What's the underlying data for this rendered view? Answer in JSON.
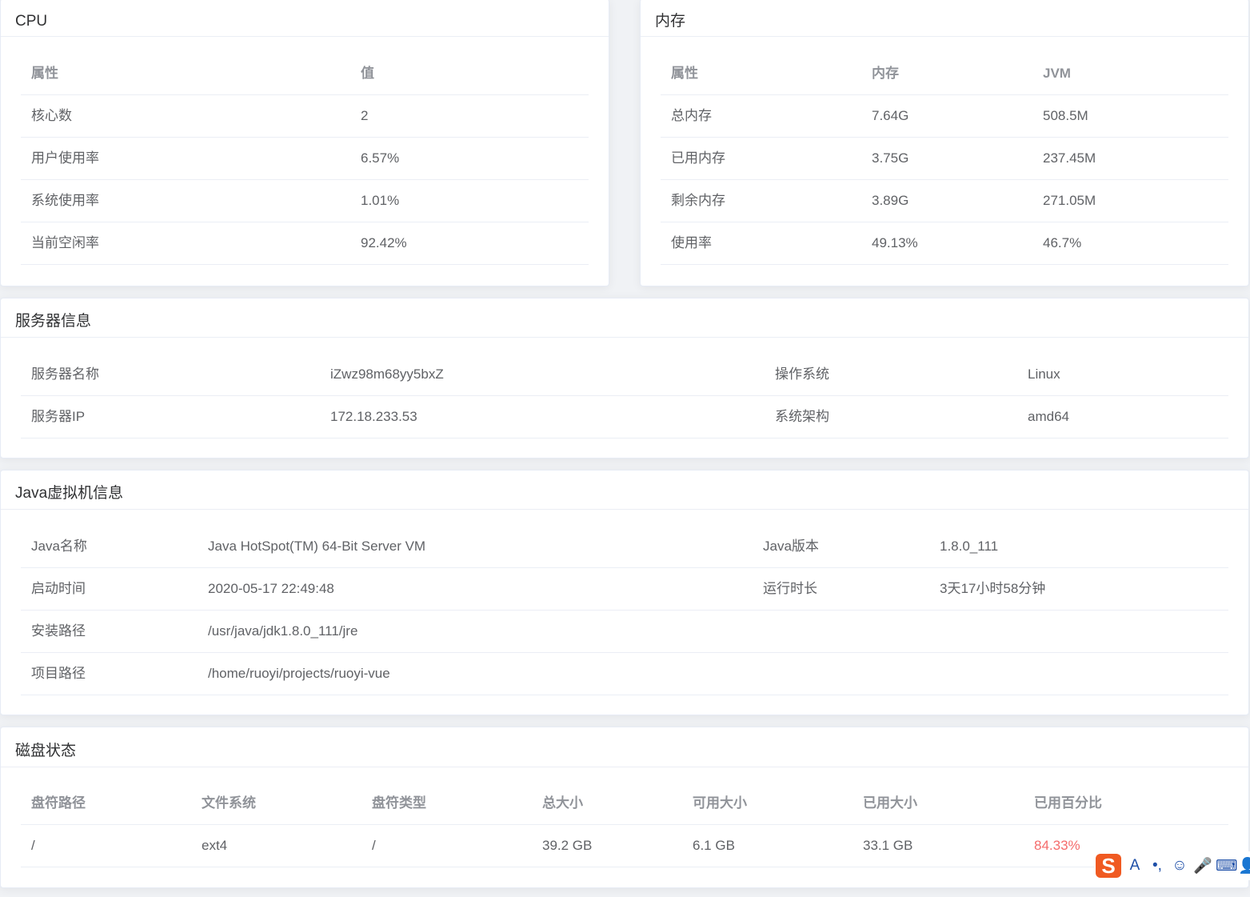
{
  "cpu": {
    "title": "CPU",
    "headers": [
      "属性",
      "值"
    ],
    "rows": [
      [
        "核心数",
        "2"
      ],
      [
        "用户使用率",
        "6.57%"
      ],
      [
        "系统使用率",
        "1.01%"
      ],
      [
        "当前空闲率",
        "92.42%"
      ]
    ]
  },
  "mem": {
    "title": "内存",
    "headers": [
      "属性",
      "内存",
      "JVM"
    ],
    "rows": [
      [
        "总内存",
        "7.64G",
        "508.5M"
      ],
      [
        "已用内存",
        "3.75G",
        "237.45M"
      ],
      [
        "剩余内存",
        "3.89G",
        "271.05M"
      ],
      [
        "使用率",
        "49.13%",
        "46.7%"
      ]
    ]
  },
  "server": {
    "title": "服务器信息",
    "rows": [
      [
        "服务器名称",
        "iZwz98m68yy5bxZ",
        "操作系统",
        "Linux"
      ],
      [
        "服务器IP",
        "172.18.233.53",
        "系统架构",
        "amd64"
      ]
    ]
  },
  "jvm": {
    "title": "Java虚拟机信息",
    "rows": [
      [
        "Java名称",
        "Java HotSpot(TM) 64-Bit Server VM",
        "Java版本",
        "1.8.0_111"
      ],
      [
        "启动时间",
        "2020-05-17 22:49:48",
        "运行时长",
        "3天17小时58分钟"
      ],
      [
        "安装路径",
        "/usr/java/jdk1.8.0_111/jre",
        "",
        ""
      ],
      [
        "项目路径",
        "/home/ruoyi/projects/ruoyi-vue",
        "",
        ""
      ]
    ]
  },
  "disk": {
    "title": "磁盘状态",
    "headers": [
      "盘符路径",
      "文件系统",
      "盘符类型",
      "总大小",
      "可用大小",
      "已用大小",
      "已用百分比"
    ],
    "rows": [
      [
        "/",
        "ext4",
        "/",
        "39.2 GB",
        "6.1 GB",
        "33.1 GB",
        "84.33%"
      ]
    ],
    "danger_color": "#f56c6c"
  },
  "ime": {
    "logo": "S",
    "icons": [
      "A",
      "•,",
      "☺",
      "🎤",
      "⌨",
      "👤"
    ]
  }
}
